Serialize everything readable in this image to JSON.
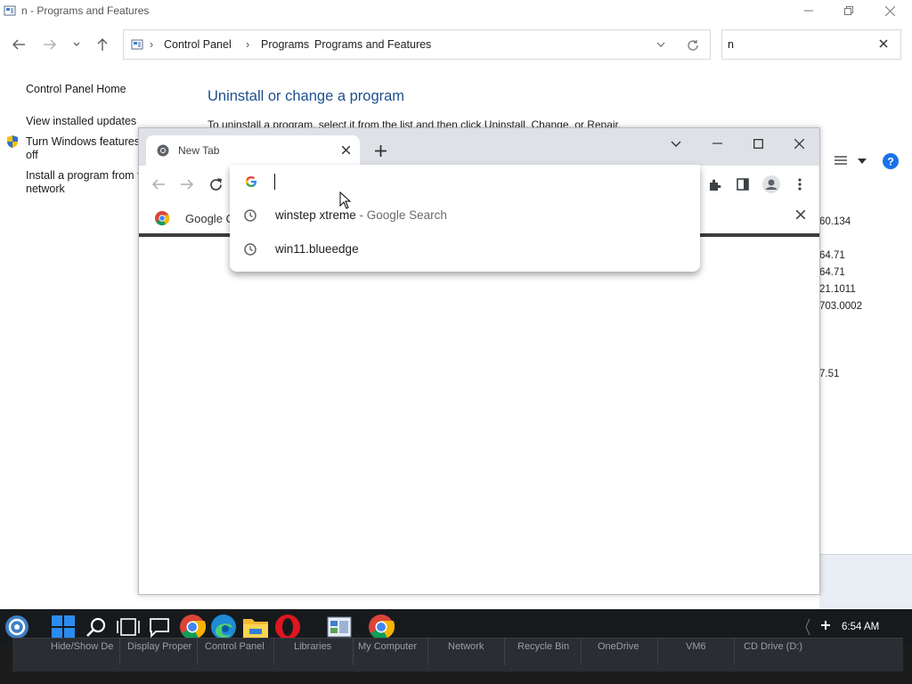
{
  "control_panel": {
    "window_title": "n - Programs and Features",
    "breadcrumbs": [
      "Control Panel",
      "Programs",
      "Programs and Features"
    ],
    "search_value": "n",
    "sidebar": {
      "home": "Control Panel Home",
      "view_updates": "View installed updates",
      "features_line1": "Turn Windows features o",
      "features_line2": "off",
      "install_line1": "Install a program from tl",
      "install_line2": "network"
    },
    "heading": "Uninstall or change a program",
    "description": "To uninstall a program, select it from the list and then click Uninstall, Change, or Repair.",
    "versions": [
      "60.134",
      "64.71",
      "64.71",
      "21.1011",
      "703.0002",
      "7.51"
    ]
  },
  "chrome": {
    "tab_title": "New Tab",
    "bookmark_label": "Google C",
    "omnibox_value": "",
    "suggestions": [
      {
        "text": "winstep xtreme",
        "sub": " - Google Search"
      },
      {
        "text": "win11.blueedge",
        "sub": ""
      }
    ]
  },
  "taskbar": {
    "clock": "6:54 AM",
    "dock_items": [
      "Hide/Show De",
      "Display Proper",
      "Control Panel",
      "Libraries",
      "My Computer",
      "Network",
      "Recycle Bin",
      "OneDrive",
      "VM6",
      "CD Drive (D:)"
    ]
  },
  "colors": {
    "heading_blue": "#1e4f8d",
    "help_blue": "#1a73e8",
    "taskbar_bg": "#171a1d"
  }
}
